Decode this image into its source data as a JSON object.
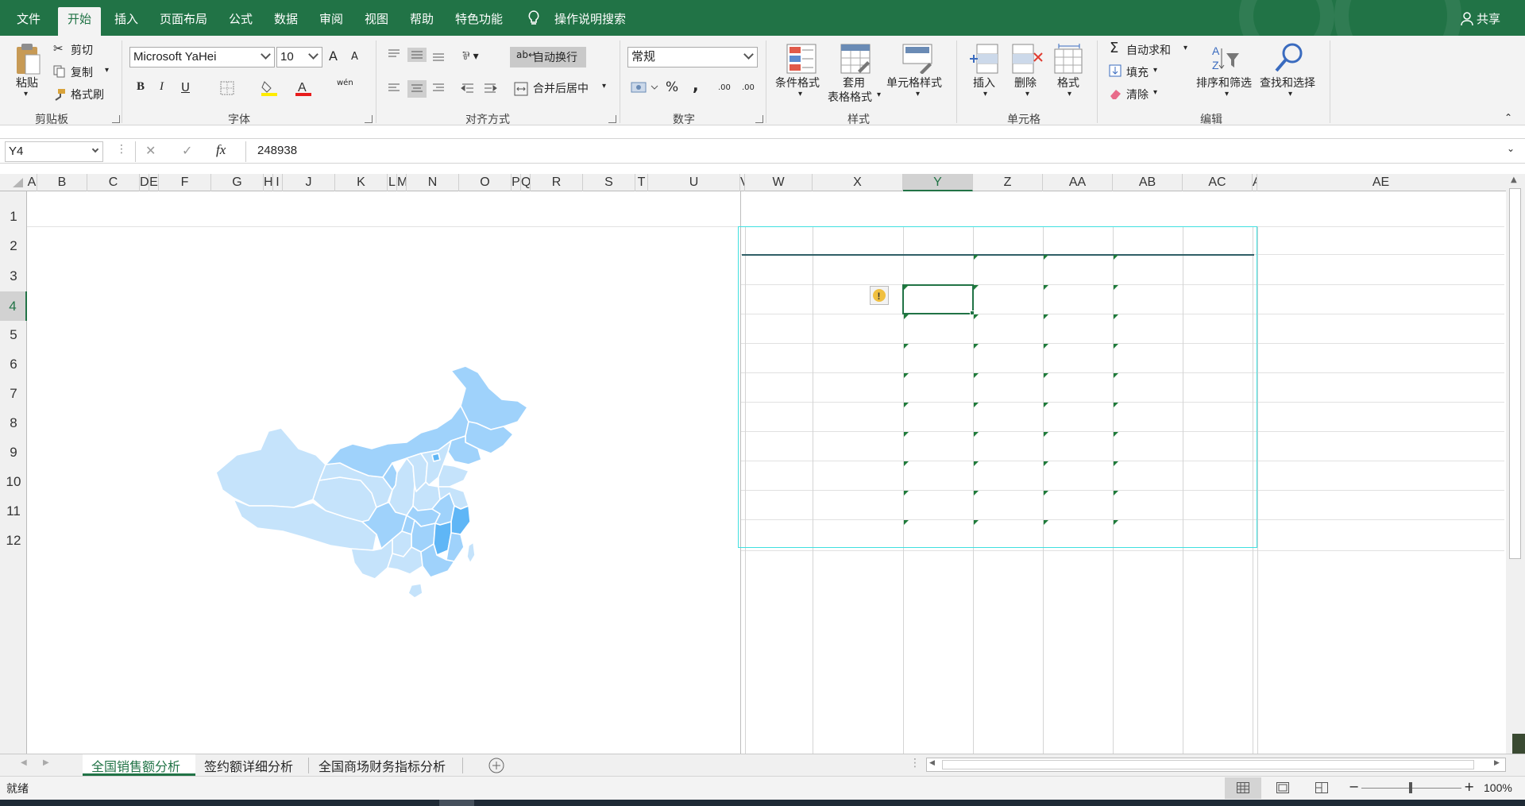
{
  "menu": {
    "tabs": [
      "文件",
      "开始",
      "插入",
      "页面布局",
      "公式",
      "数据",
      "审阅",
      "视图",
      "帮助",
      "特色功能"
    ],
    "tell_me": "操作说明搜索",
    "share": "共享"
  },
  "ribbon": {
    "clipboard": {
      "paste": "粘贴",
      "cut": "剪切",
      "copy": "复制",
      "format_painter": "格式刷",
      "label": "剪贴板"
    },
    "font": {
      "name": "Microsoft YaHei",
      "size": "10",
      "bold": "B",
      "italic": "I",
      "underline": "U",
      "increase": "A",
      "decrease": "A",
      "phonetic": "wén",
      "label": "字体"
    },
    "alignment": {
      "wrap": "自动换行",
      "merge": "合并后居中",
      "label": "对齐方式"
    },
    "number": {
      "format": "常规",
      "percent": "%",
      "comma": ",",
      "inc_dec": ".00",
      "dec_dec": ".00",
      "label": "数字"
    },
    "styles": {
      "conditional": "条件格式",
      "table_format_1": "套用",
      "table_format_2": "表格格式",
      "cell_styles": "单元格样式",
      "label": "样式"
    },
    "cells": {
      "insert": "插入",
      "delete": "删除",
      "format": "格式",
      "label": "单元格"
    },
    "editing": {
      "autosum": "自动求和",
      "fill": "填充",
      "clear": "清除",
      "sort": "排序和筛选",
      "find": "查找和选择",
      "label": "编辑"
    }
  },
  "formula_bar": {
    "name_box": "Y4",
    "cancel": "✕",
    "enter": "✓",
    "fx": "fx",
    "value": "248938"
  },
  "columns": [
    "A",
    "B",
    "C",
    "D",
    "E",
    "F",
    "G",
    "H",
    "I",
    "J",
    "K",
    "L",
    "M",
    "N",
    "O",
    "P",
    "Q",
    "R",
    "S",
    "T",
    "U",
    "V",
    "W",
    "X",
    "Y",
    "Z",
    "AA",
    "AB",
    "AC",
    "A",
    "AE"
  ],
  "rows": [
    "1",
    "2",
    "3",
    "4",
    "5",
    "6",
    "7",
    "8",
    "9",
    "10",
    "11",
    "12"
  ],
  "sheets": {
    "active": "全国销售额分析",
    "tab2": "签约额详细分析",
    "tab3": "全国商场财务指标分析"
  },
  "status": {
    "ready": "就绪",
    "zoom": "100%"
  },
  "colors": {
    "accent": "#217346",
    "map_light": "#c5e3fb",
    "map_mid": "#9fd2fb",
    "map_dark": "#5fb6f6",
    "selection": "#40e0e0"
  }
}
